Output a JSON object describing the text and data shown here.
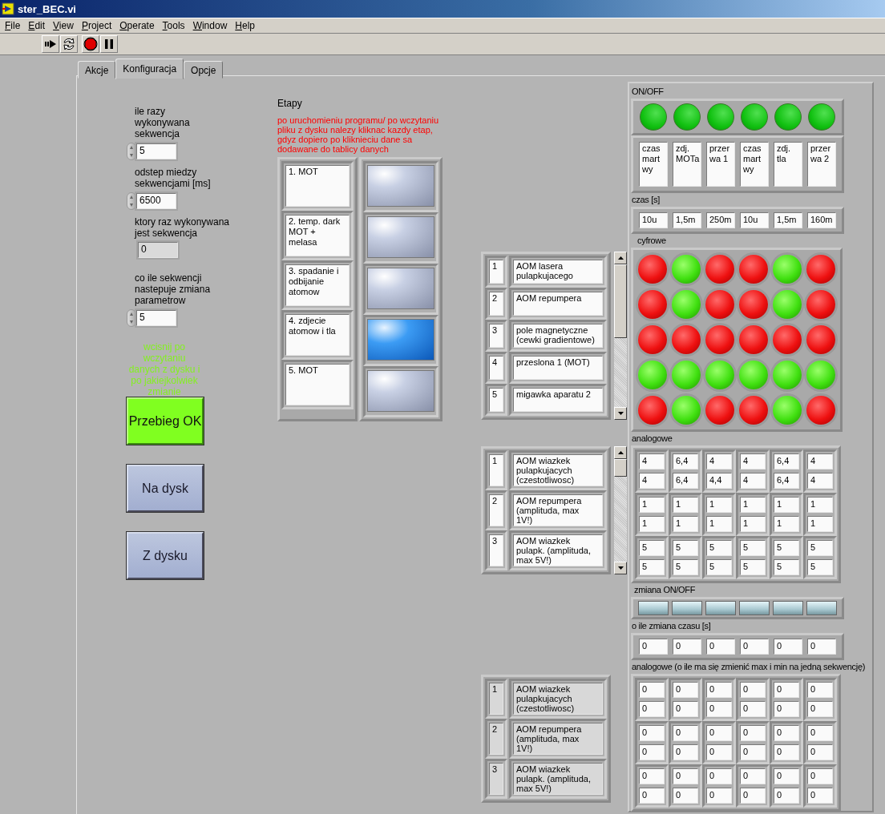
{
  "window": {
    "title": "ster_BEC.vi"
  },
  "menu": [
    "File",
    "Edit",
    "View",
    "Project",
    "Operate",
    "Tools",
    "Window",
    "Help"
  ],
  "tabs": [
    {
      "label": "Akcje",
      "selected": false
    },
    {
      "label": "Konfiguracja",
      "selected": true
    },
    {
      "label": "Opcje",
      "selected": false
    }
  ],
  "controls": [
    {
      "kind": "numeric",
      "label": "ile razy\nwykonywana\nsekwencja",
      "value": "5"
    },
    {
      "kind": "numeric",
      "label": "odstep miedzy\nsekwencjami [ms]",
      "value": "6500"
    },
    {
      "kind": "indicator",
      "label": "ktory raz wykonywana\njest sekwencja",
      "value": "0"
    },
    {
      "kind": "numeric",
      "label": "co ile sekwencji\nnastepuje zmiana\nparametrow",
      "value": "5"
    }
  ],
  "note": "wcisnij po\nwczytaniu\ndanych z dysku i\npo jakiejkolwiek\nzmianie",
  "buttons": [
    {
      "label": "Przebieg OK",
      "on": true
    },
    {
      "label": "Na dysk",
      "on": false
    },
    {
      "label": "Z dysku",
      "on": false
    }
  ],
  "stages": {
    "label": "Etapy",
    "hint": "po uruchomieniu programu/ po wczytaniu\npliku z dysku nalezy kliknac kazdy etap,\ngdyz dopiero po kliknieciu dane sa\ndodawane do tablicy danych",
    "items": [
      {
        "name": "1. MOT",
        "selected": false
      },
      {
        "name": "2. temp. dark\nMOT +\nmelasa",
        "selected": false
      },
      {
        "name": "3. spadanie i\nodbijanie\natomow",
        "selected": false
      },
      {
        "name": "4. zdjecie\natomow i tla",
        "selected": true
      },
      {
        "name": "5. MOT",
        "selected": false
      }
    ]
  },
  "channel_lists": [
    {
      "disabled": false,
      "scrollable": true,
      "items": [
        {
          "index": "1",
          "name": "AOM lasera\npulapkujacego"
        },
        {
          "index": "2",
          "name": "AOM repumpera"
        },
        {
          "index": "3",
          "name": "pole magnetyczne\n(cewki gradientowe)"
        },
        {
          "index": "4",
          "name": "przeslona 1 (MOT)"
        },
        {
          "index": "5",
          "name": "migawka aparatu 2"
        }
      ]
    },
    {
      "disabled": false,
      "scrollable": true,
      "items": [
        {
          "index": "1",
          "name": "AOM wiazkek\npulapkujacych\n(czestotliwosc)"
        },
        {
          "index": "2",
          "name": "AOM repumpera\n(amplituda, max\n1V!)"
        },
        {
          "index": "3",
          "name": "AOM wiazkek\npulapk. (amplituda,\nmax 5V!)"
        }
      ]
    },
    {
      "disabled": true,
      "scrollable": false,
      "items": [
        {
          "index": "1",
          "name": "AOM wiazkek\npulapkujacych\n(czestotliwosc)"
        },
        {
          "index": "2",
          "name": "AOM repumpera\n(amplituda, max\n1V!)"
        },
        {
          "index": "3",
          "name": "AOM wiazkek\npulapk. (amplituda,\nmax 5V!)"
        }
      ]
    }
  ],
  "sequence": {
    "onoff_label": "ON/OFF",
    "onoff": [
      true,
      true,
      true,
      true,
      true,
      true
    ],
    "names": [
      "czas\nmart\nwy",
      "zdj.\nMOTa",
      "przer\nwa 1",
      "czas\nmart\nwy",
      "zdj.\ntla",
      "przer\nwa 2"
    ],
    "time_label": "czas [s]",
    "times": [
      "10u",
      "1,5m",
      "250m",
      "10u",
      "1,5m",
      "160m"
    ],
    "digital_label": "cyfrowe",
    "digital": [
      [
        false,
        true,
        false,
        false,
        true,
        false
      ],
      [
        false,
        true,
        false,
        false,
        true,
        false
      ],
      [
        false,
        false,
        false,
        false,
        false,
        false
      ],
      [
        true,
        true,
        true,
        true,
        true,
        true
      ],
      [
        false,
        true,
        false,
        false,
        true,
        false
      ]
    ],
    "analog_label": "analogowe",
    "analog": [
      [
        [
          "4",
          "4"
        ],
        [
          "6,4",
          "6,4"
        ],
        [
          "4",
          "4,4"
        ],
        [
          "4",
          "4"
        ],
        [
          "6,4",
          "6,4"
        ],
        [
          "4",
          "4"
        ]
      ],
      [
        [
          "1",
          "1"
        ],
        [
          "1",
          "1"
        ],
        [
          "1",
          "1"
        ],
        [
          "1",
          "1"
        ],
        [
          "1",
          "1"
        ],
        [
          "1",
          "1"
        ]
      ],
      [
        [
          "5",
          "5"
        ],
        [
          "5",
          "5"
        ],
        [
          "5",
          "5"
        ],
        [
          "5",
          "5"
        ],
        [
          "5",
          "5"
        ],
        [
          "5",
          "5"
        ]
      ]
    ],
    "change_label": "zmiana ON/OFF",
    "change": [
      false,
      false,
      false,
      false,
      false,
      false
    ],
    "time_change_label": "o ile zmiana czasu [s]",
    "time_change": [
      "0",
      "0",
      "0",
      "0",
      "0",
      "0"
    ],
    "analog_change_label": "analogowe (o ile ma się zmienić max i min na jedną sekwencję)",
    "analog_change": [
      [
        [
          "0",
          "0"
        ],
        [
          "0",
          "0"
        ],
        [
          "0",
          "0"
        ],
        [
          "0",
          "0"
        ],
        [
          "0",
          "0"
        ],
        [
          "0",
          "0"
        ]
      ],
      [
        [
          "0",
          "0"
        ],
        [
          "0",
          "0"
        ],
        [
          "0",
          "0"
        ],
        [
          "0",
          "0"
        ],
        [
          "0",
          "0"
        ],
        [
          "0",
          "0"
        ]
      ],
      [
        [
          "0",
          "0"
        ],
        [
          "0",
          "0"
        ],
        [
          "0",
          "0"
        ],
        [
          "0",
          "0"
        ],
        [
          "0",
          "0"
        ],
        [
          "0",
          "0"
        ]
      ]
    ]
  }
}
